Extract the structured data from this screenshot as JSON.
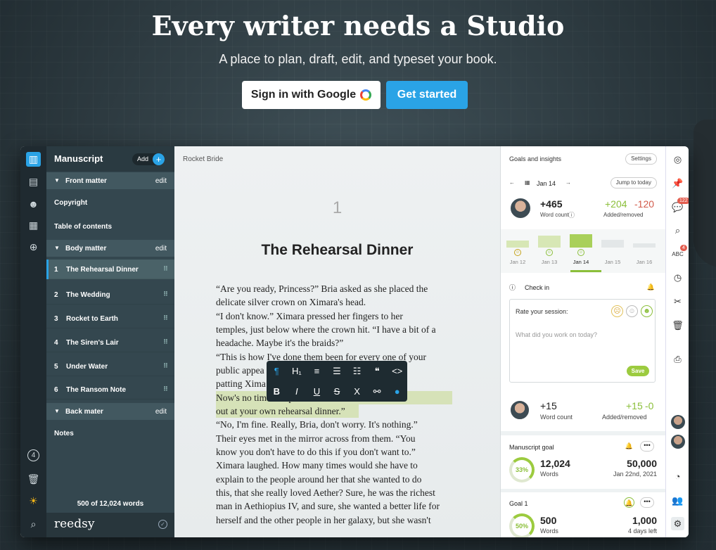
{
  "hero": {
    "title": "Every writer needs a Studio",
    "subtitle": "A place to plan, draft, edit, and typeset your book.",
    "google_button": "Sign in with Google",
    "start_button": "Get started"
  },
  "sidebar": {
    "title": "Manuscript",
    "add_label": "Add",
    "sections": [
      {
        "label": "Front matter",
        "edit": "edit"
      },
      {
        "label": "Body matter",
        "edit": "edit"
      },
      {
        "label": "Back mater",
        "edit": "edit"
      }
    ],
    "front_items": [
      "Copyright",
      "Table of contents"
    ],
    "chapters": [
      {
        "num": "1",
        "label": "The Rehearsal Dinner"
      },
      {
        "num": "2",
        "label": "The Wedding"
      },
      {
        "num": "3",
        "label": "Rocket to Earth"
      },
      {
        "num": "4",
        "label": "The Siren's Lair"
      },
      {
        "num": "5",
        "label": "Under Water"
      },
      {
        "num": "6",
        "label": "The Ransom Note"
      }
    ],
    "back_items": [
      "Notes"
    ],
    "word_count": "500 of 12,024 words",
    "brand": "reedsy",
    "rail_badge": "4"
  },
  "editor": {
    "book_title": "Rocket Bride",
    "chapter_number": "1",
    "chapter_title": "The Rehearsal Dinner",
    "lines": [
      "“Are you ready, Princess?” Bria asked as she placed the",
      "delicate silver crown on Ximara's head.",
      "    “I don't know.” Ximara pressed her fingers to her",
      "temples, just below where the crown hit. “I have a bit of a",
      "headache. Maybe it's the braids?”",
      "    “This is how I've done them been for every one of your",
      "public appea                                         she paused,",
      "patting Xima                                           rough?",
      "Now's no tim                                          nt to pass",
      "out at your own rehearsal dinner.”",
      "    “No, I'm fine. Really, Bria, don't worry. It's nothing.”",
      "    Their eyes met in the mirror across from them. “You",
      "know you don't have to do this if you don't want to.”",
      "Ximara laughed. How many times would she have to",
      "explain to the people around her that she wanted to do",
      "this, that she really loved Aether? Sure, he was the richest",
      "man in Aethiopius IV, and sure, she wanted a better life for",
      "herself and the other people in her galaxy, but she wasn't"
    ]
  },
  "toolbar": {
    "row1": [
      "¶",
      "H₁",
      "≡",
      "☰",
      "☷",
      "❝",
      "<>"
    ],
    "row2": [
      "B",
      "I",
      "U",
      "S",
      "X",
      "⚯",
      "●"
    ]
  },
  "panel": {
    "title": "Goals and insights",
    "settings": "Settings",
    "date": "Jan 14",
    "jump": "Jump to today",
    "session_words": "+465",
    "session_words_label": "Word count",
    "added": "+204",
    "removed": "-120",
    "added_removed_label": "Added/removed",
    "days": [
      "Jan 12",
      "Jan 13",
      "Jan 14",
      "Jan 15",
      "Jan 16"
    ],
    "day_bars": [
      0.45,
      0.75,
      0.85,
      0.5,
      0.25
    ],
    "checkin": "Check in",
    "rate": "Rate your session:",
    "placeholder": "What did you work on today?",
    "save": "Save",
    "user_words": "+15",
    "user_words_label": "Word count",
    "user_added": "+15",
    "user_removed": "-0",
    "user_ar_label": "Added/removed",
    "manuscript_goal": "Manuscript goal",
    "mg_percent": "33%",
    "mg_words": "12,024",
    "mg_words_label": "Words",
    "mg_target": "50,000",
    "mg_date": "Jan 22nd, 2021",
    "goal1": "Goal 1",
    "g1_percent": "50%",
    "g1_words": "500",
    "g1_words_label": "Words",
    "g1_target": "1,000",
    "g1_left": "4 days left"
  },
  "rrail": {
    "badge1": "122",
    "badge2": "4"
  },
  "colors": {
    "accent": "#2aa3e6",
    "goal_green": "#8bbf3a",
    "sidebar": "#34474f"
  }
}
